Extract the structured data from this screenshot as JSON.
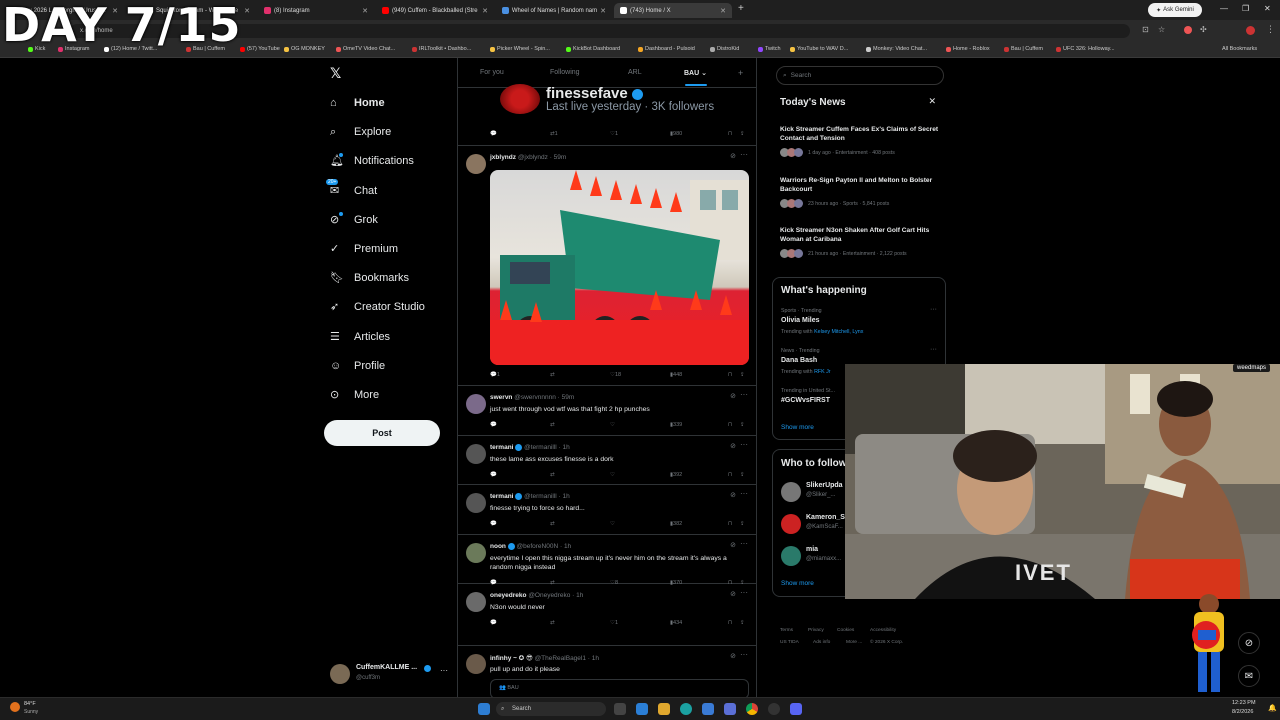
{
  "overlay": {
    "title": "DAY 7/15"
  },
  "browser": {
    "tabs": [
      {
        "label": "New 2026 Lamborghini Urus SE",
        "color": "#d44"
      },
      {
        "label": "SquidRon Stream - Watch Live",
        "color": "#53fc18"
      },
      {
        "label": "(8) Instagram",
        "color": "#e1306c"
      },
      {
        "label": "(949) Cuffem - Blackballed (Stre",
        "color": "#f00"
      },
      {
        "label": "Wheel of Names | Random nam",
        "color": "#4a90e2"
      },
      {
        "label": "(743) Home / X",
        "color": "#fff"
      }
    ],
    "ask_gemini": "Ask Gemini",
    "address": "x.com/home",
    "bookmarks": [
      "Kick",
      "Instagram",
      "(12) Home / Twitt...",
      "Bau | Cuffem",
      "(57) YouTube",
      "OG MONKEY",
      "OmeTV Video Chat...",
      "IRLToolkit • Dashbo...",
      "Picker Wheel - Spin...",
      "KickBot Dashboard",
      "Dashboard - Pulsoid",
      "DistroKid",
      "Twitch",
      "YouTube to WAV D...",
      "Monkey: Video Chat...",
      "Home - Roblox",
      "Bau | Cuffem",
      "UFC 326: Holloway..."
    ],
    "all_bookmarks": "All Bookmarks"
  },
  "nav": {
    "items": [
      {
        "label": "Home",
        "icon": "home-icon"
      },
      {
        "label": "Explore",
        "icon": "search-icon"
      },
      {
        "label": "Notifications",
        "icon": "bell-icon"
      },
      {
        "label": "Chat",
        "icon": "chat-icon"
      },
      {
        "label": "Grok",
        "icon": "grok-icon"
      },
      {
        "label": "Premium",
        "icon": "premium-icon"
      },
      {
        "label": "Bookmarks",
        "icon": "bookmark-icon"
      },
      {
        "label": "Creator Studio",
        "icon": "rocket-icon"
      },
      {
        "label": "Articles",
        "icon": "article-icon"
      },
      {
        "label": "Profile",
        "icon": "person-icon"
      },
      {
        "label": "More",
        "icon": "more-circle-icon"
      }
    ],
    "chat_badge": "20+",
    "post_label": "Post",
    "account_name": "CuffemKALLME ...",
    "account_handle": "@cuff3m"
  },
  "feed": {
    "tabs": [
      "For you",
      "Following",
      "ARL",
      "BAU"
    ],
    "live_card": {
      "name": "finessefave",
      "status": "Last live yesterday · 3K followers"
    },
    "live_actions": {
      "retweets": "1",
      "likes": "1",
      "views": "980"
    },
    "posts": [
      {
        "name": "jxblyndz",
        "handle": "@jxblyndz · 59m",
        "text": "",
        "replies": "1",
        "retweets": "",
        "likes": "18",
        "views": "448",
        "has_image": true
      },
      {
        "name": "swervn",
        "handle": "@swervnnnnn · 59m",
        "text": "just went through vod wtf was that fight 2 hp punches",
        "replies": "",
        "retweets": "",
        "likes": "",
        "views": "339"
      },
      {
        "name": "termani",
        "handle": "@termanilll · 1h",
        "text": "these lame ass excuses finesse is a dork",
        "replies": "",
        "retweets": "",
        "likes": "",
        "views": "392"
      },
      {
        "name": "termani",
        "handle": "@termanilll · 1h",
        "text": "finesse trying to force so hard...",
        "replies": "",
        "retweets": "",
        "likes": "",
        "views": "382"
      },
      {
        "name": "noon",
        "handle": "@beforeN00N · 1h",
        "text": "everytime I open this nigga stream up it's never him on the stream it's always a random nigga instead",
        "replies": "",
        "retweets": "",
        "likes": "8",
        "views": "370"
      },
      {
        "name": "oneyedreko",
        "handle": "@Oneyedreko · 1h",
        "text": "N3on would never",
        "replies": "",
        "retweets": "",
        "likes": "1",
        "views": "434"
      },
      {
        "name": "infinhy ~ ✪ 😎",
        "handle": "@TheRealBagel1 · 1h",
        "text": "pull up and do it please",
        "quote": "BAU"
      }
    ]
  },
  "right": {
    "search_placeholder": "Search",
    "todays_news": {
      "title": "Today's News",
      "items": [
        {
          "title": "Kick Streamer Cuffem Faces Ex's Claims of Secret Contact and Tension",
          "meta": "1 day ago · Entertainment · 408 posts"
        },
        {
          "title": "Warriors Re-Sign Payton II and Melton to Bolster Backcourt",
          "meta": "23 hours ago · Sports · 5,841 posts"
        },
        {
          "title": "Kick Streamer N3on Shaken After Golf Cart Hits Woman at Caribana",
          "meta": "21 hours ago · Entertainment · 2,122 posts"
        }
      ]
    },
    "whats_happening": {
      "title": "What's happening",
      "trends": [
        {
          "meta": "Sports · Trending",
          "name": "Olivia Miles",
          "sub": "Trending with",
          "sub_link": "Kelsey Mitchell, Lynx"
        },
        {
          "meta": "News · Trending",
          "name": "Dana Bash",
          "sub": "Trending with",
          "sub_link": "RFK Jr"
        },
        {
          "meta": "Trending in United St...",
          "name": "#GCWvsFIRST",
          "sub": "",
          "sub_link": ""
        }
      ],
      "show_more": "Show more"
    },
    "who_to_follow": {
      "title": "Who to follow",
      "users": [
        {
          "name": "SlikerUpda",
          "handle": "@Sliker_..."
        },
        {
          "name": "Kameron_S",
          "handle": "@KamScaF..."
        },
        {
          "name": "mia",
          "handle": "@miamaxx..."
        }
      ],
      "show_more": "Show more"
    },
    "footer": [
      "Terms",
      "Privacy",
      "Cookies",
      "Accessibility",
      "US TIDA",
      "Ads info",
      "More ...",
      "© 2026 X Corp."
    ]
  },
  "webcam": {
    "logo": "weedmaps",
    "shirt_text": "IVET"
  },
  "taskbar": {
    "weather_temp": "84°F",
    "weather_desc": "Sunny",
    "search": "Search",
    "time": "12:23 PM",
    "date": "8/2/2026"
  },
  "colors": {
    "accent": "#1d9bf0",
    "bg": "#000000",
    "border": "#2f3336",
    "muted": "#71767b"
  }
}
